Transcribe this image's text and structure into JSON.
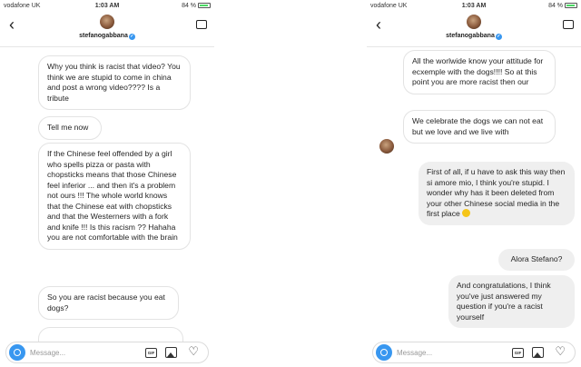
{
  "status_bar": {
    "carrier": "vodafone UK",
    "time": "1:03 AM",
    "battery": "84 %"
  },
  "chat": {
    "username": "stefanogabbana",
    "composer_placeholder": "Message...",
    "gif_label": "GIF"
  },
  "left_messages": [
    "Why you think is racist that video? You think we are stupid to come in china and post a wrong video???? Is a tribute",
    "Tell me now",
    "If the Chinese feel offended by a girl who spells pizza or pasta with chopsticks means that those Chinese feel inferior ... and then it's a problem not ours  !!! The whole world knows that the Chinese eat with chopsticks and that the Westerners with a fork and knife !!! Is this racism ?? Hahaha you are not comfortable with the brain",
    "So you are racist because you eat dogs?"
  ],
  "right_messages": {
    "received_1": "All the worlwide know your attitude for ecxemple with the dogs!!!! So at this point you are more racist then our",
    "received_2": "We celebrate the dogs we can not eat but we love and we live with",
    "sent_1": "First of all, if u have to ask this way then si amore mio, I think you're stupid. I wonder why has it been deleted from your other Chinese social media in the first place",
    "sent_2": "Alora Stefano?",
    "sent_3": "And congratulations, I think you've just answered my question if you're a racist yourself"
  },
  "colors": {
    "accent": "#3897f0",
    "sent_bubble": "#efefef",
    "received_border": "#e3e3e3"
  },
  "icons": [
    "back-icon",
    "verified-icon",
    "video-call-icon",
    "camera-icon",
    "gif-icon",
    "image-icon",
    "heart-icon",
    "emoji-icon"
  ]
}
